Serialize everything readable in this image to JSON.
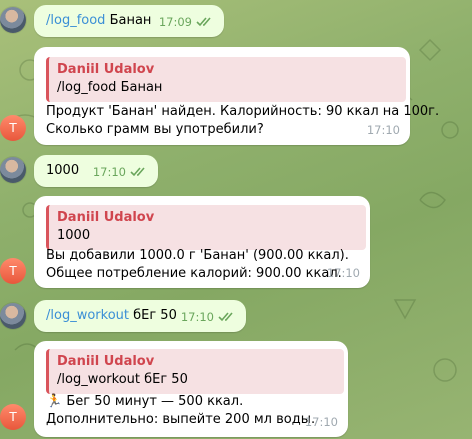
{
  "messages": [
    {
      "command": "/log_food",
      "text": " Банан",
      "time": "17:09"
    },
    {
      "reply_name": "Daniil Udalov",
      "reply_text": "/log_food Банан",
      "line1": "Продукт 'Банан' найден. Калорийность: 90 ккал на 100г.",
      "line2": "Сколько грамм вы употребили?",
      "time": "17:10",
      "avatar": "T"
    },
    {
      "text": "1000",
      "time": "17:10"
    },
    {
      "reply_name": "Daniil Udalov",
      "reply_text": "1000",
      "line1": "Вы добавили 1000.0 г 'Банан' (900.00 ккал).",
      "line2": "Общее потребление калорий: 900.00 ккал.",
      "time": "17:10",
      "avatar": "T"
    },
    {
      "command": "/log_workout",
      "text": " бЕг 50",
      "time": "17:10"
    },
    {
      "reply_name": "Daniil Udalov",
      "reply_text": "/log_workout бЕг 50",
      "line1_emoji": "🏃",
      "line1": " Бег 50 минут — 500 ккал.",
      "line2": "Дополнительно: выпейте 200 мл воды.",
      "time": "17:10",
      "avatar": "T"
    }
  ],
  "colors": {
    "outgoing": "#eefedf",
    "incoming": "#ffffff",
    "link": "#3b8fd6",
    "reply_accent": "#d9545c"
  }
}
